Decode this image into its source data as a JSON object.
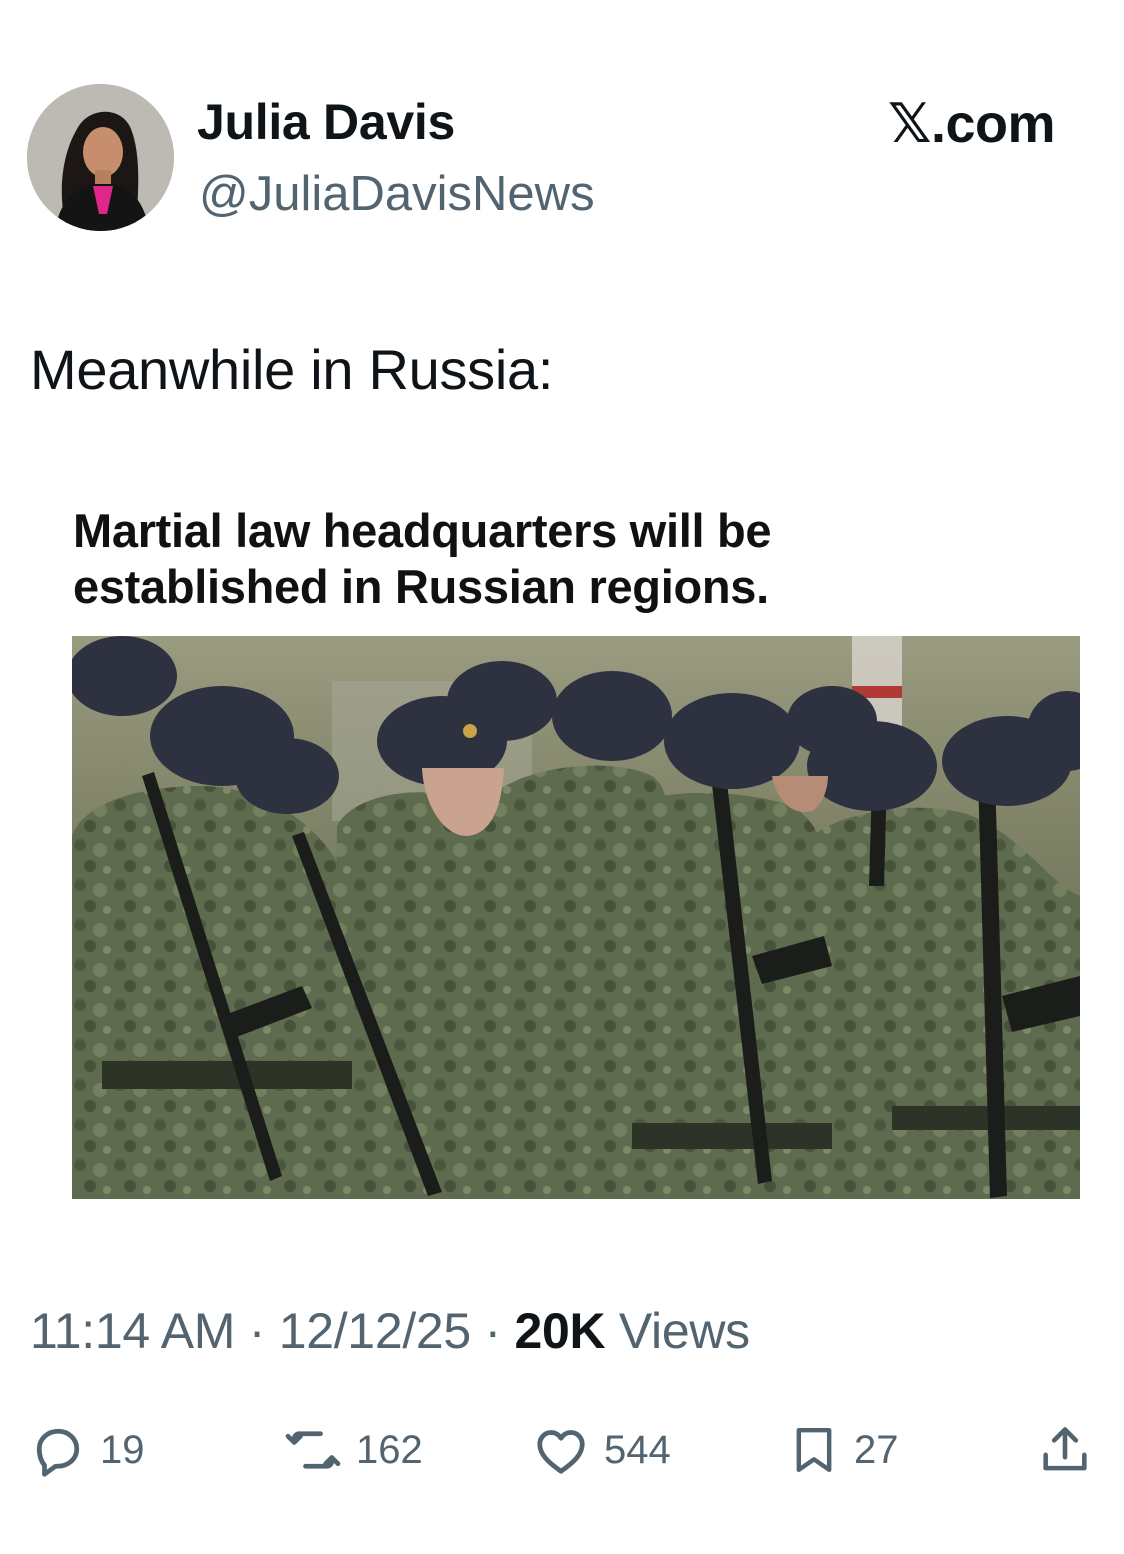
{
  "author": {
    "name": "Julia Davis",
    "handle": "@JuliaDavisNews",
    "avatar_icon": "profile-photo"
  },
  "brand": {
    "mark": "𝕏",
    "domain": ".com"
  },
  "tweet": {
    "text": "Meanwhile in Russia:",
    "headline_line1": "Martial law headquarters will be",
    "headline_line2": "established in Russian regions.",
    "photo_subject": "soldiers-in-fur-hats-photo"
  },
  "meta": {
    "time": "11:14 AM",
    "separator": "·",
    "date": "12/12/25",
    "views_count": "20K",
    "views_label": "Views"
  },
  "actions": {
    "replies": {
      "icon": "reply-icon",
      "count": "19"
    },
    "reposts": {
      "icon": "repost-icon",
      "count": "162"
    },
    "likes": {
      "icon": "heart-icon",
      "count": "544"
    },
    "bookmarks": {
      "icon": "bookmark-icon",
      "count": "27"
    },
    "share": {
      "icon": "share-icon"
    }
  },
  "colors": {
    "text_primary": "#0f1419",
    "text_secondary": "#536471",
    "background": "#ffffff"
  }
}
